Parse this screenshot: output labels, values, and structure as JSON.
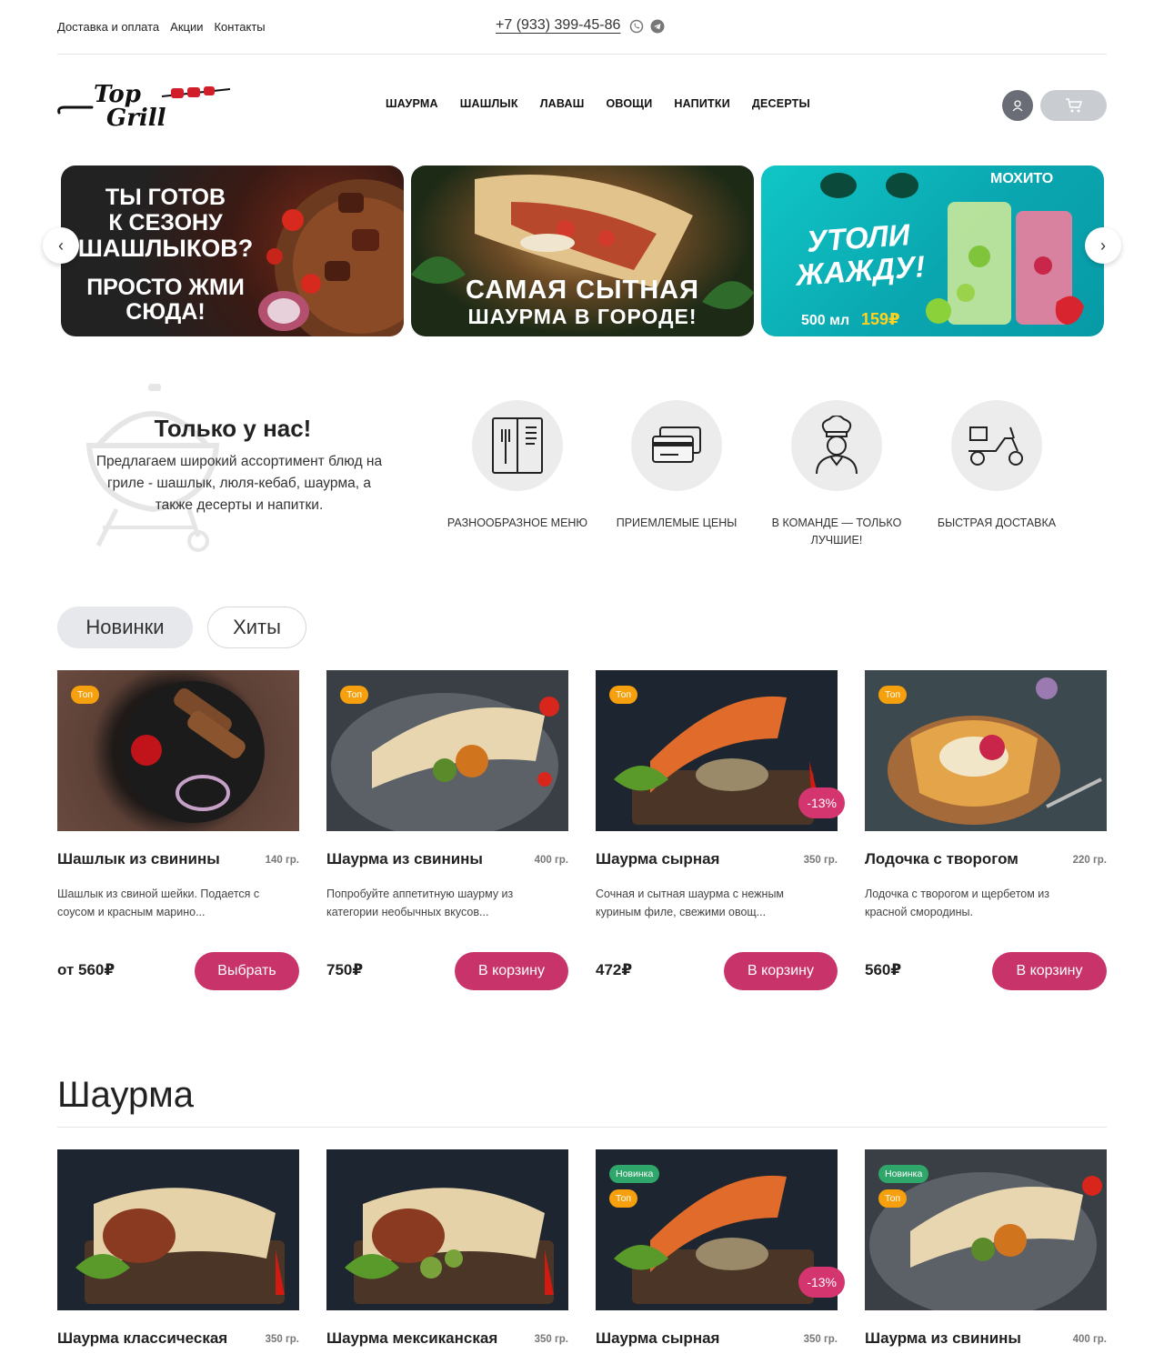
{
  "topbar": {
    "links": [
      "Доставка и оплата",
      "Акции",
      "Контакты"
    ],
    "phone": "+7 (933) 399-45-86",
    "messengers": [
      "whatsapp-icon",
      "telegram-icon"
    ]
  },
  "header": {
    "logo_text_1": "Top",
    "logo_text_2": "Grill",
    "nav": [
      "ШАУРМА",
      "ШАШЛЫК",
      "ЛАВАШ",
      "ОВОЩИ",
      "НАПИТКИ",
      "ДЕСЕРТЫ"
    ],
    "user_icon": "user-icon",
    "cart_icon": "cart-icon"
  },
  "banners": [
    {
      "lines": [
        "ТЫ ГОТОВ",
        "К СЕЗОНУ",
        "ШАШЛЫКОВ?",
        "ПРОСТО ЖМИ",
        "СЮДА!"
      ]
    },
    {
      "lines": [
        "САМАЯ СЫТНАЯ",
        "ШАУРМА В ГОРОДЕ!"
      ]
    },
    {
      "lines": [
        "МОХИТО",
        "УТОЛИ",
        "ЖАЖДУ!",
        "500 мл",
        "159₽"
      ]
    }
  ],
  "about": {
    "title": "Только у нас!",
    "text": "Предлагаем широкий ассортимент блюд на гриле - шашлык, люля-кебаб, шаурма, а также десерты и напитки."
  },
  "features": [
    {
      "icon": "menu-book-icon",
      "label": "Разнообразное меню"
    },
    {
      "icon": "credit-card-icon",
      "label": "Приемлемые цены"
    },
    {
      "icon": "chef-icon",
      "label": "В команде — только лучшие!"
    },
    {
      "icon": "scooter-icon",
      "label": "Быстрая доставка"
    }
  ],
  "tabs": {
    "active": "Новинки",
    "inactive": "Хиты"
  },
  "hits": [
    {
      "badges": [
        "Топ"
      ],
      "discount": "",
      "name": "Шашлык из свинины",
      "weight": "140 гр.",
      "desc": "Шашлык из свиной шейки. Подается с соусом и красным марино...",
      "price": "от 560₽",
      "button": "Выбрать"
    },
    {
      "badges": [
        "Топ"
      ],
      "discount": "",
      "name": "Шаурма из свинины",
      "weight": "400 гр.",
      "desc": "Попробуйте аппетитную шаурму из категории необычных вкусов...",
      "price": "750₽",
      "button": "В корзину"
    },
    {
      "badges": [
        "Топ"
      ],
      "discount": "-13%",
      "name": "Шаурма сырная",
      "weight": "350 гр.",
      "desc": "Сочная и сытная шаурма с нежным куриным филе, свежими овощ...",
      "price": "472₽",
      "button": "В корзину"
    },
    {
      "badges": [
        "Топ"
      ],
      "discount": "",
      "name": "Лодочка с творогом",
      "weight": "220 гр.",
      "desc": "Лодочка с творогом и щербетом из красной смородины.",
      "price": "560₽",
      "button": "В корзину"
    }
  ],
  "section": {
    "title": "Шаурма"
  },
  "shawarma": [
    {
      "badges": [],
      "discount": "",
      "name": "Шаурма классическая",
      "weight": "350 гр."
    },
    {
      "badges": [],
      "discount": "",
      "name": "Шаурма мексиканская",
      "weight": "350 гр."
    },
    {
      "badges": [
        "Новинка",
        "Топ"
      ],
      "discount": "-13%",
      "name": "Шаурма сырная",
      "weight": "350 гр."
    },
    {
      "badges": [
        "Новинка",
        "Топ"
      ],
      "discount": "",
      "name": "Шаурма из свинины",
      "weight": "400 гр."
    }
  ],
  "colors": {
    "accent": "#c8336a",
    "top_badge": "#f5a00c",
    "new_badge": "#2fa76a"
  }
}
